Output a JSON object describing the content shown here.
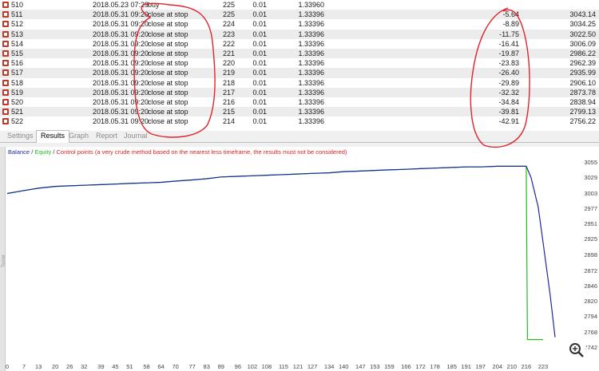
{
  "table": {
    "rows": [
      {
        "num": "510",
        "time": "2018.05.23 07:29",
        "type": "buy",
        "order": "225",
        "volume": "0.01",
        "price": "1.33960",
        "profit": "",
        "balance": ""
      },
      {
        "num": "511",
        "time": "2018.05.31 09:20",
        "type": "close at stop",
        "order": "225",
        "volume": "0.01",
        "price": "1.33396",
        "profit": "-5.64",
        "balance": "3043.14"
      },
      {
        "num": "512",
        "time": "2018.05.31 09:20",
        "type": "close at stop",
        "order": "224",
        "volume": "0.01",
        "price": "1.33396",
        "profit": "-8.89",
        "balance": "3034.25"
      },
      {
        "num": "513",
        "time": "2018.05.31 09:20",
        "type": "close at stop",
        "order": "223",
        "volume": "0.01",
        "price": "1.33396",
        "profit": "-11.75",
        "balance": "3022.50"
      },
      {
        "num": "514",
        "time": "2018.05.31 09:20",
        "type": "close at stop",
        "order": "222",
        "volume": "0.01",
        "price": "1.33396",
        "profit": "-16.41",
        "balance": "3006.09"
      },
      {
        "num": "515",
        "time": "2018.05.31 09:20",
        "type": "close at stop",
        "order": "221",
        "volume": "0.01",
        "price": "1.33396",
        "profit": "-19.87",
        "balance": "2986.22"
      },
      {
        "num": "516",
        "time": "2018.05.31 09:20",
        "type": "close at stop",
        "order": "220",
        "volume": "0.01",
        "price": "1.33396",
        "profit": "-23.83",
        "balance": "2962.39"
      },
      {
        "num": "517",
        "time": "2018.05.31 09:20",
        "type": "close at stop",
        "order": "219",
        "volume": "0.01",
        "price": "1.33396",
        "profit": "-26.40",
        "balance": "2935.99"
      },
      {
        "num": "518",
        "time": "2018.05.31 09:20",
        "type": "close at stop",
        "order": "218",
        "volume": "0.01",
        "price": "1.33396",
        "profit": "-29.89",
        "balance": "2906.10"
      },
      {
        "num": "519",
        "time": "2018.05.31 09:20",
        "type": "close at stop",
        "order": "217",
        "volume": "0.01",
        "price": "1.33396",
        "profit": "-32.32",
        "balance": "2873.78"
      },
      {
        "num": "520",
        "time": "2018.05.31 09:20",
        "type": "close at stop",
        "order": "216",
        "volume": "0.01",
        "price": "1.33396",
        "profit": "-34.84",
        "balance": "2838.94"
      },
      {
        "num": "521",
        "time": "2018.05.31 09:20",
        "type": "close at stop",
        "order": "215",
        "volume": "0.01",
        "price": "1.33396",
        "profit": "-39.81",
        "balance": "2799.13"
      },
      {
        "num": "522",
        "time": "2018.05.31 09:20",
        "type": "close at stop",
        "order": "214",
        "volume": "0.01",
        "price": "1.33396",
        "profit": "-42.91",
        "balance": "2756.22"
      }
    ]
  },
  "tabs": [
    {
      "label": "Settings",
      "active": false
    },
    {
      "label": "Results",
      "active": true
    },
    {
      "label": "Graph",
      "active": false
    },
    {
      "label": "Report",
      "active": false
    },
    {
      "label": "Journal",
      "active": false
    }
  ],
  "graph": {
    "legend_balance": "Balance",
    "legend_sep1": " / ",
    "legend_equity": "Equity",
    "legend_sep2": " / ",
    "legend_control": "Control points (a very crude method based on the nearest less timeframe, the results must not be considered)",
    "sidebar_label": "Tester"
  },
  "colors": {
    "balance": "#1c2a9c",
    "equity": "#22bb22",
    "control": "#e02020",
    "annotation": "#e0242a"
  },
  "icons": {
    "row_icon": "order-icon",
    "zoom": "zoom-in-icon"
  },
  "chart_data": {
    "type": "line",
    "x_ticks": [
      "0",
      "7",
      "13",
      "20",
      "26",
      "32",
      "39",
      "45",
      "51",
      "58",
      "64",
      "70",
      "77",
      "83",
      "89",
      "96",
      "102",
      "108",
      "115",
      "121",
      "127",
      "134",
      "140",
      "147",
      "153",
      "159",
      "166",
      "172",
      "178",
      "185",
      "191",
      "197",
      "204",
      "210",
      "216",
      "223"
    ],
    "y_ticks": [
      "3055",
      "3029",
      "3003",
      "2977",
      "2951",
      "2925",
      "2898",
      "2872",
      "2846",
      "2820",
      "2794",
      "2768",
      "2742"
    ],
    "ylim": [
      2742,
      3055
    ],
    "xlim": [
      0,
      228
    ],
    "series": [
      {
        "name": "Balance",
        "x": [
          0,
          7,
          13,
          20,
          26,
          32,
          39,
          45,
          51,
          58,
          64,
          70,
          77,
          83,
          89,
          96,
          102,
          108,
          115,
          121,
          127,
          134,
          140,
          147,
          153,
          159,
          166,
          172,
          178,
          185,
          191,
          197,
          204,
          210,
          216,
          218,
          221,
          223,
          226,
          228
        ],
        "y": [
          3003,
          3008,
          3012,
          3015,
          3016,
          3017,
          3018,
          3019,
          3020,
          3021,
          3022,
          3024,
          3026,
          3028,
          3031,
          3032,
          3033,
          3034,
          3035,
          3036,
          3037,
          3038,
          3040,
          3041,
          3042,
          3043,
          3044,
          3045,
          3046,
          3047,
          3048,
          3048,
          3049,
          3049,
          3049,
          3030,
          2980,
          2920,
          2830,
          2760
        ]
      },
      {
        "name": "Equity",
        "x": [
          0,
          7,
          13,
          20,
          26,
          32,
          39,
          45,
          51,
          58,
          64,
          70,
          77,
          83,
          89,
          96,
          102,
          108,
          115,
          121,
          127,
          134,
          140,
          147,
          153,
          159,
          166,
          172,
          178,
          185,
          191,
          197,
          204,
          210,
          215,
          216,
          216.5,
          221,
          223
        ],
        "y": [
          3003,
          3008,
          3012,
          3015,
          3016,
          3017,
          3018,
          3019,
          3020,
          3021,
          3022,
          3024,
          3026,
          3028,
          3031,
          3032,
          3033,
          3034,
          3035,
          3036,
          3037,
          3038,
          3040,
          3041,
          3042,
          3043,
          3044,
          3045,
          3046,
          3047,
          3048,
          3048,
          3049,
          3049,
          3049,
          3049,
          2756,
          2756,
          2756
        ]
      }
    ],
    "grid": false
  }
}
